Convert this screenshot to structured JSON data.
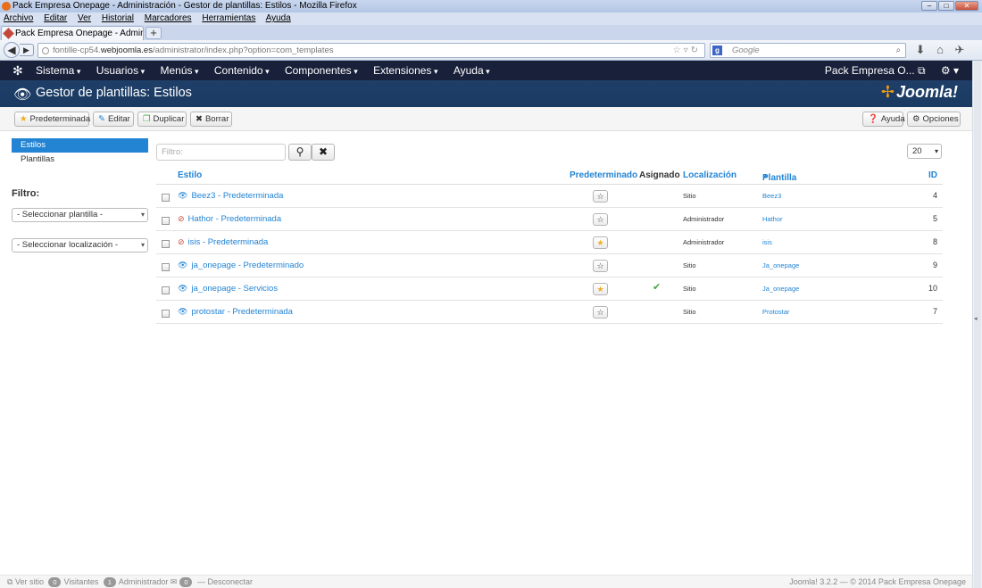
{
  "window": {
    "title": "Pack Empresa Onepage - Administración - Gestor de plantillas: Estilos - Mozilla Firefox"
  },
  "browser_menu": [
    "Archivo",
    "Editar",
    "Ver",
    "Historial",
    "Marcadores",
    "Herramientas",
    "Ayuda"
  ],
  "tab": {
    "label": "Pack Empresa Onepage - Administració..."
  },
  "address": {
    "prefix": "fontille-cp54.",
    "host": "webjoomla.es",
    "path": "/administrator/index.php?option=com_templates"
  },
  "search": {
    "placeholder": "Google",
    "engine_letter": "g"
  },
  "joomla_nav": {
    "items": [
      "Sistema",
      "Usuarios",
      "Menús",
      "Contenido",
      "Componentes",
      "Extensiones",
      "Ayuda"
    ],
    "site_name": "Pack Empresa O..."
  },
  "header": {
    "title": "Gestor de plantillas: Estilos",
    "brand": "Joomla!"
  },
  "toolbar": {
    "default_label": "Predeterminada",
    "edit_label": "Editar",
    "duplicate_label": "Duplicar",
    "delete_label": "Borrar",
    "help_label": "Ayuda",
    "options_label": "Opciones"
  },
  "sidebar": {
    "items": [
      {
        "label": "Estilos"
      },
      {
        "label": "Plantillas"
      }
    ],
    "filter_heading": "Filtro:",
    "select_template": "- Seleccionar plantilla -",
    "select_location": "- Seleccionar localización -"
  },
  "list_filter": {
    "placeholder": "Filtro:",
    "limit": "20"
  },
  "table": {
    "headers": {
      "style": "Estilo",
      "default": "Predeterminado",
      "assigned": "Asignado",
      "location": "Localización",
      "template": "Plantilla",
      "template_sort": "▲",
      "id": "ID"
    },
    "rows": [
      {
        "name": "Beez3 - Predeterminada",
        "preview": "eye",
        "default": false,
        "assigned": "",
        "location": "Sitio",
        "template": "Beez3",
        "id": "4"
      },
      {
        "name": "Hathor - Predeterminada",
        "preview": "eye-slash",
        "default": false,
        "assigned": "",
        "location": "Administrador",
        "template": "Hathor",
        "id": "5"
      },
      {
        "name": "isis - Predeterminada",
        "preview": "eye-slash",
        "default": true,
        "assigned": "",
        "location": "Administrador",
        "template": "isis",
        "id": "8"
      },
      {
        "name": "ja_onepage - Predeterminado",
        "preview": "eye",
        "default": false,
        "assigned": "",
        "location": "Sitio",
        "template": "Ja_onepage",
        "id": "9"
      },
      {
        "name": "ja_onepage - Servicios",
        "preview": "eye",
        "default": true,
        "assigned": "✔",
        "location": "Sitio",
        "template": "Ja_onepage",
        "id": "10"
      },
      {
        "name": "protostar - Predeterminada",
        "preview": "eye",
        "default": false,
        "assigned": "",
        "location": "Sitio",
        "template": "Protostar",
        "id": "7"
      }
    ]
  },
  "footer": {
    "view_site": "Ver sitio",
    "visitors_count": "0",
    "visitors_label": "Visitantes",
    "admins_count": "1",
    "admins_label": "Administrador",
    "messages_count": "0",
    "logout": "Desconectar",
    "version": "Joomla! 3.2.2",
    "copyright": "— © 2014 Pack Empresa Onepage"
  },
  "colors": {
    "accent": "#2384d3",
    "nav_bg": "#19203a",
    "header_bg": "#1b3a62",
    "star_on": "#f0ad1e",
    "check": "#46a546"
  },
  "icons": {
    "star": "star-icon",
    "edit": "edit-icon",
    "copy": "copy-icon",
    "delete": "x-icon",
    "help": "question-icon",
    "options": "gear-icon",
    "preview": "eye-icon"
  }
}
